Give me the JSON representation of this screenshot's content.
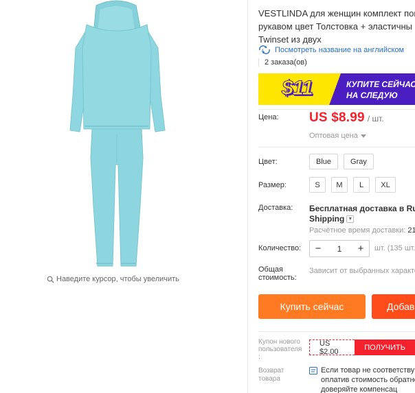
{
  "gallery": {
    "zoom_hint": "Наведите курсор, чтобы увеличить",
    "product_color": "#8fd7e0"
  },
  "product": {
    "title_lines": [
      "VESTLINDA для женщин комплект пов",
      "рукавом цвет Толстовка + эластичны",
      "Twinset из двух"
    ],
    "translate_link": "Посмотреть название на английском",
    "orders": "2 заказа(ов)"
  },
  "banner": {
    "amount": "$11",
    "text_line1": "КУПИТЕ СЕЙЧАС",
    "text_line2": "НА СЛЕДУЮ"
  },
  "price": {
    "label": "Цена:",
    "value": "US $8.99",
    "unit": "/ шт.",
    "wholesale": "Оптовая цена"
  },
  "color": {
    "label": "Цвет:",
    "options": [
      "Blue",
      "Gray"
    ]
  },
  "size": {
    "label": "Размер:",
    "options": [
      "S",
      "M",
      "L",
      "XL"
    ]
  },
  "shipping": {
    "label": "Доставка:",
    "line1": "Бесплатная доставка в Russia",
    "line2": "Shipping",
    "time_label": "Расчётное время доставки:",
    "time_value": "21"
  },
  "quantity": {
    "label": "Количество:",
    "minus": "−",
    "value": "1",
    "plus": "+",
    "stock": "шт. (135 шт."
  },
  "total": {
    "label_line1": "Общая",
    "label_line2": "стоимость:",
    "note": "Зависит от выбранных характе"
  },
  "actions": {
    "buy_now": "Купить сейчас",
    "add_cart": "Добав"
  },
  "coupon": {
    "label_line1": "Купон нового",
    "label_line2": "пользователя",
    "label_line3": ":",
    "amount": "US $2.00",
    "get": "ПОЛУЧИТЬ"
  },
  "returns": {
    "label_line1": "Возврат",
    "label_line2": "товара",
    "line1": "Если товар не соответству",
    "line2": "оплатив стоимость обратно",
    "line3": "доверяйте компенсац"
  },
  "colors": {
    "accent_red": "#f5222d",
    "buy_orange": "#ff7a22",
    "cart_orange": "#ff4c1a",
    "link_blue": "#2a6ec5",
    "banner_purple": "#4b1ec1",
    "banner_yellow": "#ffe600"
  }
}
